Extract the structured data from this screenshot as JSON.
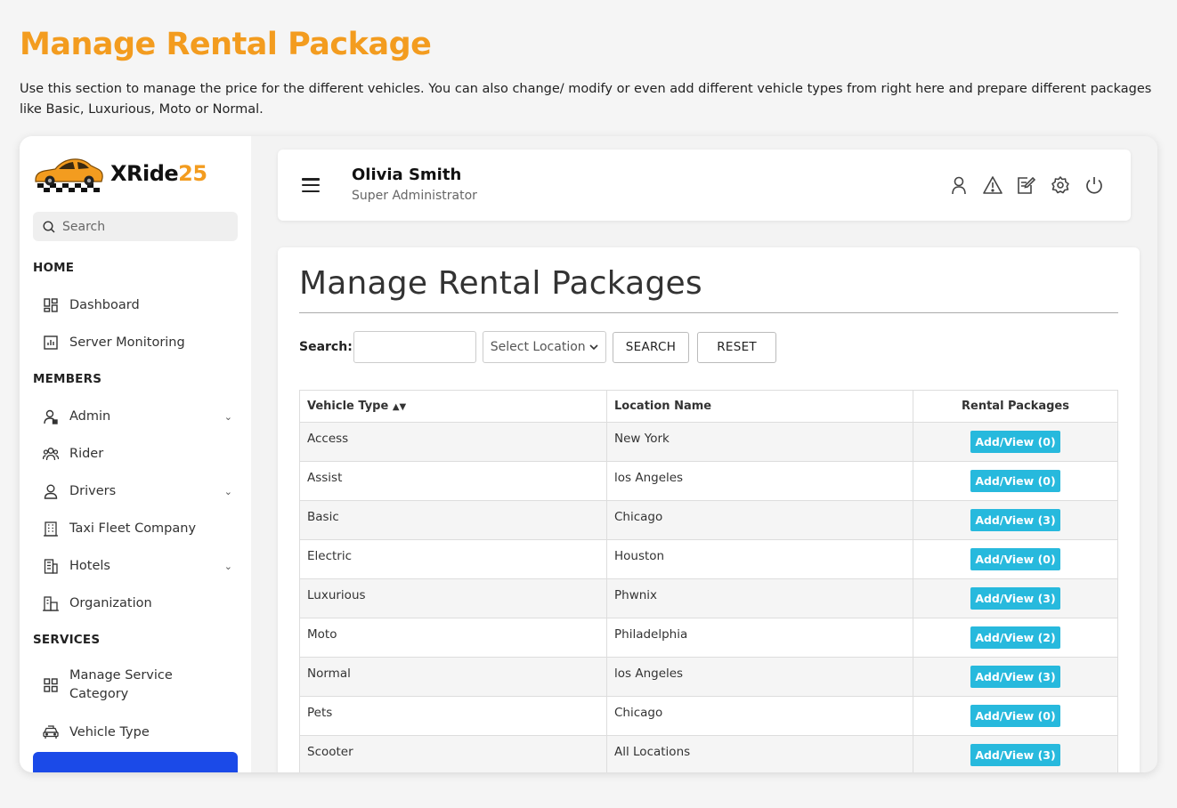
{
  "header": {
    "title": "Manage Rental Package",
    "description": "Use this section to manage the price for the different vehicles. You can also change/ modify or even add different vehicle types from right here and prepare different packages like Basic, Luxurious, Moto or Normal."
  },
  "brand": {
    "name_main": "XRide",
    "name_num": "25",
    "accent": "#f39c1f"
  },
  "sidebar": {
    "search_placeholder": "Search",
    "sections": {
      "home": "HOME",
      "members": "MEMBERS",
      "services": "SERVICES"
    },
    "items": [
      {
        "label": "Dashboard",
        "icon": "dashboard-icon"
      },
      {
        "label": "Server Monitoring",
        "icon": "chart-icon"
      },
      {
        "label": "Admin",
        "icon": "admin-user-icon"
      },
      {
        "label": "Rider",
        "icon": "rider-group-icon"
      },
      {
        "label": "Drivers",
        "icon": "driver-icon"
      },
      {
        "label": "Taxi Fleet Company",
        "icon": "building-icon"
      },
      {
        "label": "Hotels",
        "icon": "hotel-icon"
      },
      {
        "label": "Organization",
        "icon": "organization-icon"
      },
      {
        "label": "Manage Service Category",
        "icon": "grid-icon"
      },
      {
        "label": "Vehicle Type",
        "icon": "car-icon"
      }
    ]
  },
  "topbar": {
    "user_name": "Olivia Smith",
    "user_role": "Super Administrator",
    "icons": [
      "profile-icon",
      "alert-icon",
      "edit-note-icon",
      "settings-icon",
      "power-icon"
    ]
  },
  "panel": {
    "title": "Manage Rental Packages",
    "search_label": "Search:",
    "location_select": "Select Location",
    "search_button": "SEARCH",
    "reset_button": "RESET",
    "columns": [
      "Vehicle Type",
      "Location Name",
      "Rental Packages"
    ],
    "rows": [
      {
        "vehicle": "Access",
        "location": "New York",
        "packages": "Add/View (0)"
      },
      {
        "vehicle": "Assist",
        "location": "los Angeles",
        "packages": "Add/View (0)"
      },
      {
        "vehicle": "Basic",
        "location": "Chicago",
        "packages": "Add/View (3)"
      },
      {
        "vehicle": "Electric",
        "location": "Houston",
        "packages": "Add/View (0)"
      },
      {
        "vehicle": "Luxurious",
        "location": "Phwnix",
        "packages": "Add/View (3)"
      },
      {
        "vehicle": "Moto",
        "location": "Philadelphia",
        "packages": "Add/View (2)"
      },
      {
        "vehicle": "Normal",
        "location": "los Angeles",
        "packages": "Add/View (3)"
      },
      {
        "vehicle": "Pets",
        "location": "Chicago",
        "packages": "Add/View (0)"
      },
      {
        "vehicle": "Scooter",
        "location": "All Locations",
        "packages": "Add/View (3)"
      }
    ]
  },
  "colors": {
    "title_orange": "#f39c1f",
    "button_cyan": "#27b9dd",
    "active_blue": "#1b4ae8"
  }
}
